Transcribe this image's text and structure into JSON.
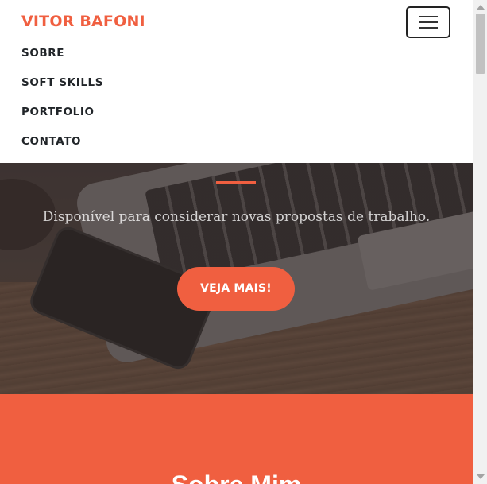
{
  "navbar": {
    "brand": "VITOR BAFONI",
    "toggler_icon": "hamburger-menu-icon",
    "links": [
      "SOBRE",
      "SOFT SKILLS",
      "PORTFOLIO",
      "CONTATO"
    ]
  },
  "hero": {
    "tagline": "Disponível para considerar novas propostas de trabalho.",
    "cta_label": "VEJA MAIS!"
  },
  "about": {
    "title": "Sobre Mim"
  },
  "colors": {
    "accent": "#f05f40",
    "text_dark": "#212529",
    "white": "#ffffff"
  }
}
